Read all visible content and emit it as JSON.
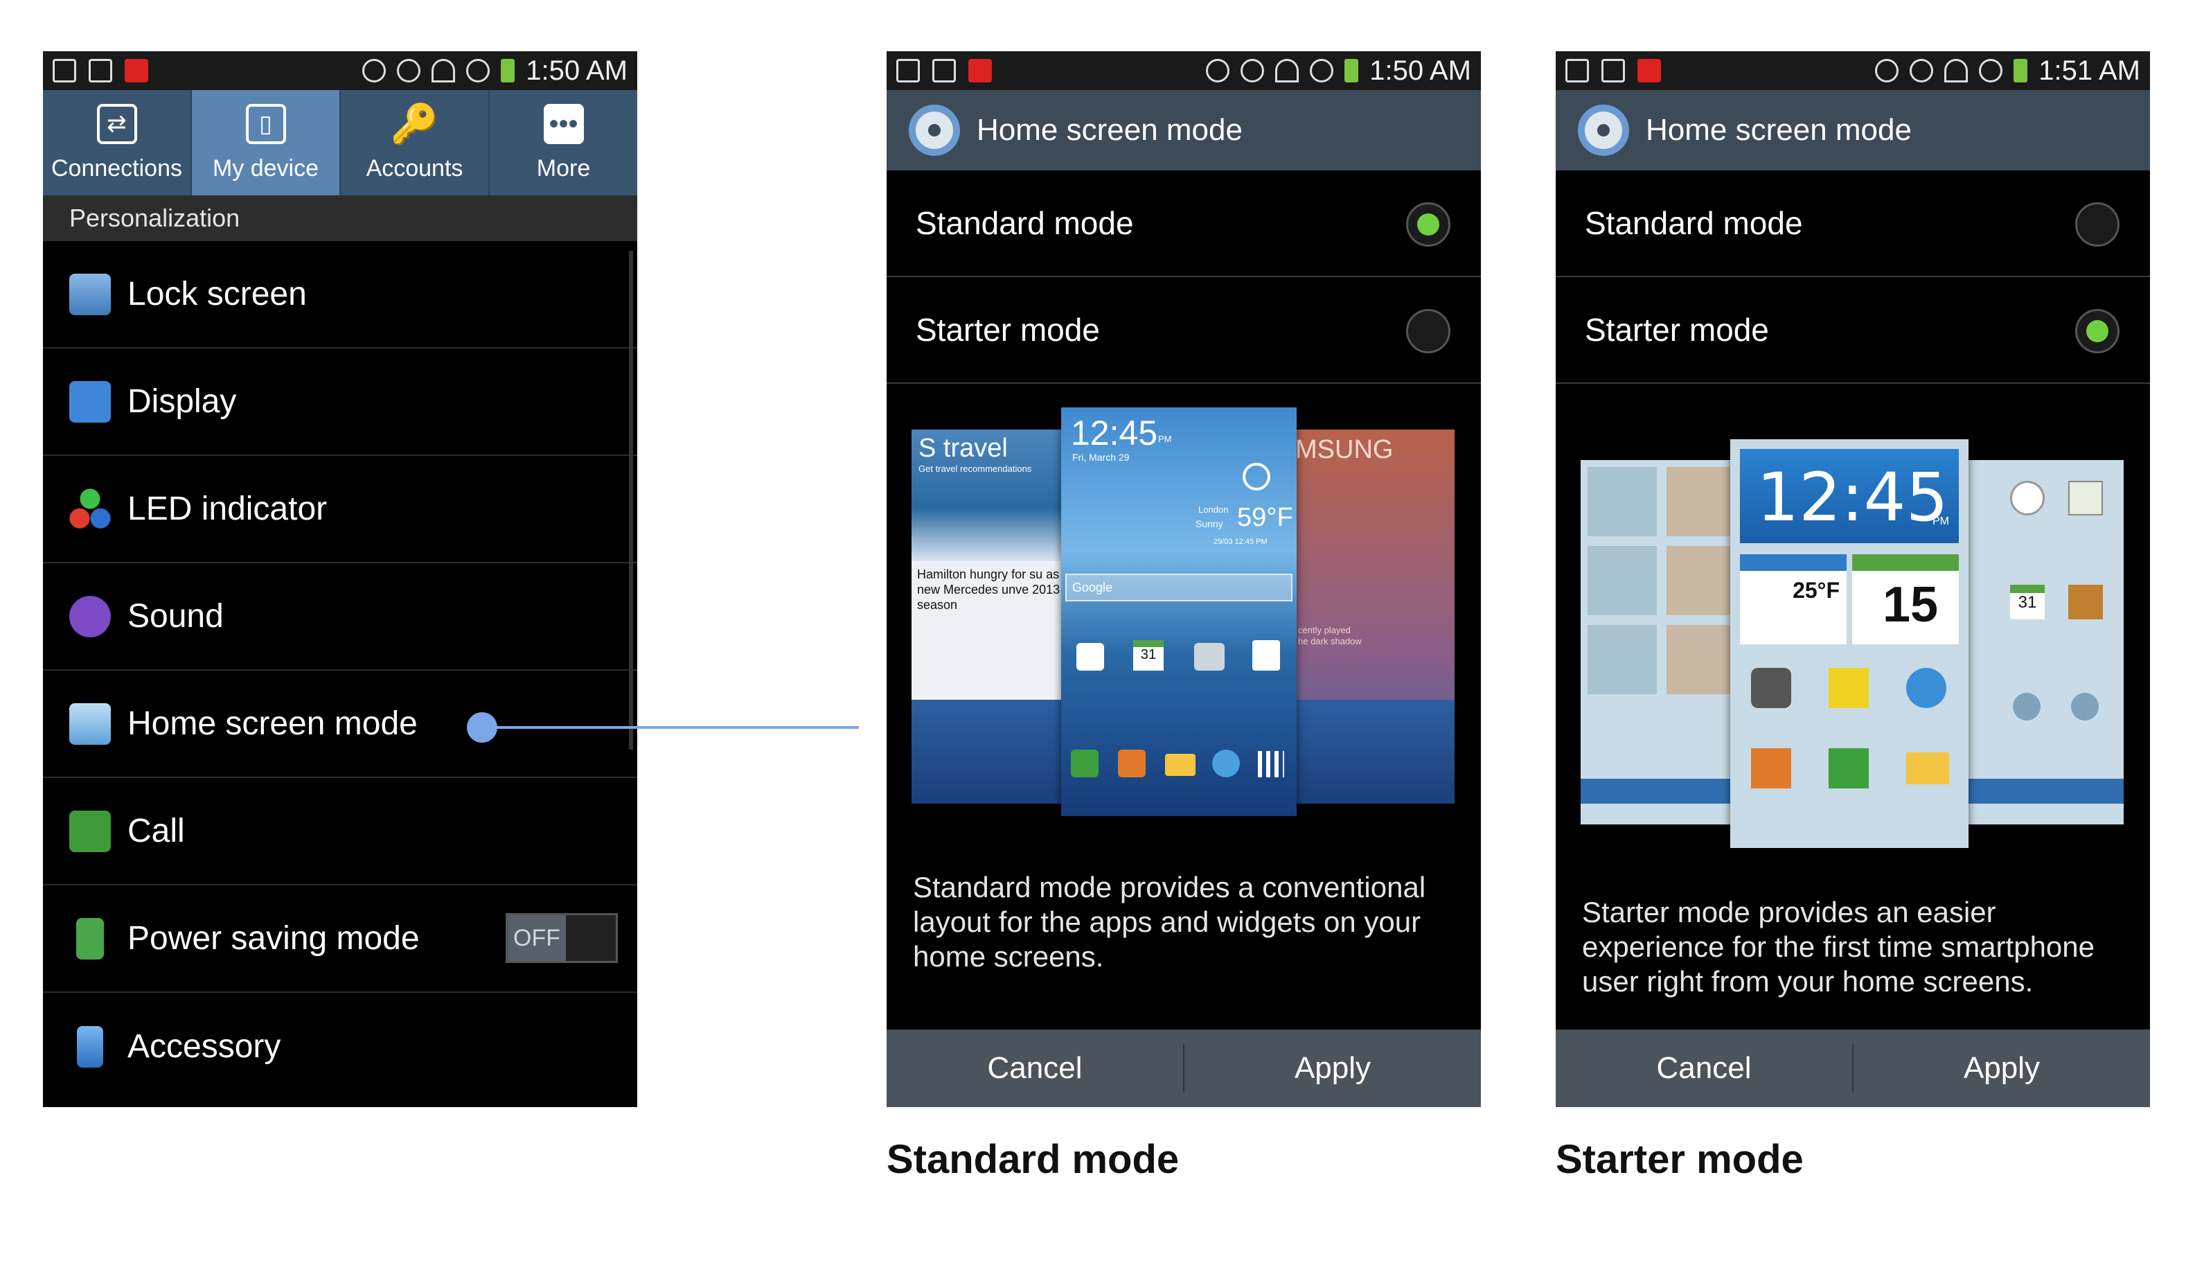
{
  "status_bar": {
    "time1": "1:50 AM",
    "time2": "1:50 AM",
    "time3": "1:51 AM"
  },
  "settings": {
    "tabs": [
      {
        "label": "Connections",
        "icon": "connections-icon"
      },
      {
        "label": "My device",
        "icon": "my-device-icon"
      },
      {
        "label": "Accounts",
        "icon": "accounts-icon"
      },
      {
        "label": "More",
        "icon": "more-icon"
      }
    ],
    "section_header": "Personalization",
    "items": [
      {
        "label": "Lock screen",
        "icon": "lock-screen-icon"
      },
      {
        "label": "Display",
        "icon": "display-icon"
      },
      {
        "label": "LED indicator",
        "icon": "led-indicator-icon"
      },
      {
        "label": "Sound",
        "icon": "sound-icon"
      },
      {
        "label": "Home screen mode",
        "icon": "home-icon"
      },
      {
        "label": "Call",
        "icon": "call-icon"
      },
      {
        "label": "Power saving mode",
        "icon": "power-saving-icon"
      },
      {
        "label": "Accessory",
        "icon": "accessory-icon"
      }
    ],
    "power_toggle": "OFF"
  },
  "standard_screen": {
    "title": "Home screen mode",
    "options": [
      "Standard mode",
      "Starter mode"
    ],
    "selected": "Standard mode",
    "description": "Standard mode provides a conventional layout for the apps and widgets on your home screens.",
    "cancel": "Cancel",
    "apply": "Apply",
    "preview": {
      "left_card_title": "S travel",
      "left_card_sub": "Get travel recommendations",
      "left_card_news": "Hamilton hungry for su as new Mercedes unve 2013 season",
      "center_time": "12:45",
      "center_ampm": "PM",
      "center_date": "Fri, March 29",
      "center_city": "London",
      "center_weather": "Sunny",
      "center_temp": "59°F",
      "center_updated": "29/03 12:45 PM",
      "center_search": "Google",
      "right_card_title": "MSUNG",
      "right_card_sub": "cently played",
      "right_card_track": "he dark shadow",
      "calendar_day": "31"
    }
  },
  "starter_screen": {
    "title": "Home screen mode",
    "options": [
      "Standard mode",
      "Starter mode"
    ],
    "selected": "Starter mode",
    "description": "Starter mode provides an easier experience for the first time smartphone user right from your home screens.",
    "cancel": "Cancel",
    "apply": "Apply",
    "preview": {
      "time": "12:45",
      "ampm": "PM",
      "temp": "25°F",
      "day": "15",
      "calendar_day": "31"
    }
  },
  "captions": {
    "standard": "Standard mode",
    "starter": "Starter mode"
  },
  "colors": {
    "accent_blue": "#5b84b0",
    "radio_green": "#6fd13f",
    "connector": "#7aa7e8"
  }
}
